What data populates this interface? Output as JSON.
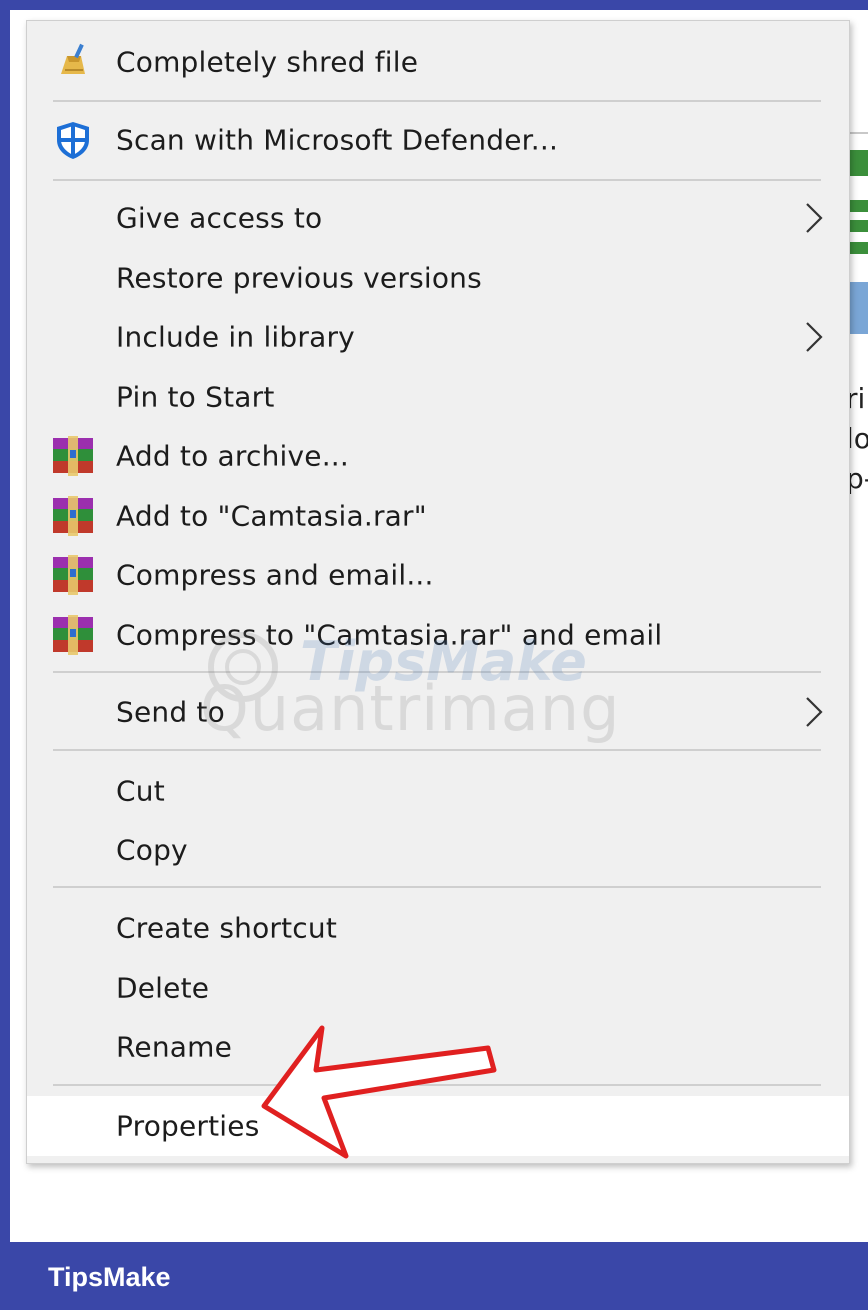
{
  "menu": {
    "items": [
      {
        "label": "Completely shred file",
        "icon": "shred-broom-icon"
      },
      {
        "label": "Scan with Microsoft Defender...",
        "icon": "defender-shield-icon"
      },
      {
        "label": "Give access to",
        "submenu": true
      },
      {
        "label": "Restore previous versions"
      },
      {
        "label": "Include in library",
        "submenu": true
      },
      {
        "label": "Pin to Start"
      },
      {
        "label": "Add to archive...",
        "icon": "winrar-icon"
      },
      {
        "label": "Add to \"Camtasia.rar\"",
        "icon": "winrar-icon"
      },
      {
        "label": "Compress and email...",
        "icon": "winrar-icon"
      },
      {
        "label": "Compress to \"Camtasia.rar\" and email",
        "icon": "winrar-icon"
      },
      {
        "label": "Send to",
        "submenu": true
      },
      {
        "label": "Cut"
      },
      {
        "label": "Copy"
      },
      {
        "label": "Create shortcut"
      },
      {
        "label": "Delete"
      },
      {
        "label": "Rename"
      },
      {
        "label": "Properties",
        "highlighted": true
      }
    ]
  },
  "background_fragments": [
    "ri",
    "lo",
    "p-"
  ],
  "watermark": {
    "top": "TipsMake",
    "bottom": "Quantrimang"
  },
  "brand": "TipsMake",
  "colors": {
    "frame": "#3a47a8",
    "menu_bg": "#f0f0f0",
    "arrow": "#e02020"
  }
}
